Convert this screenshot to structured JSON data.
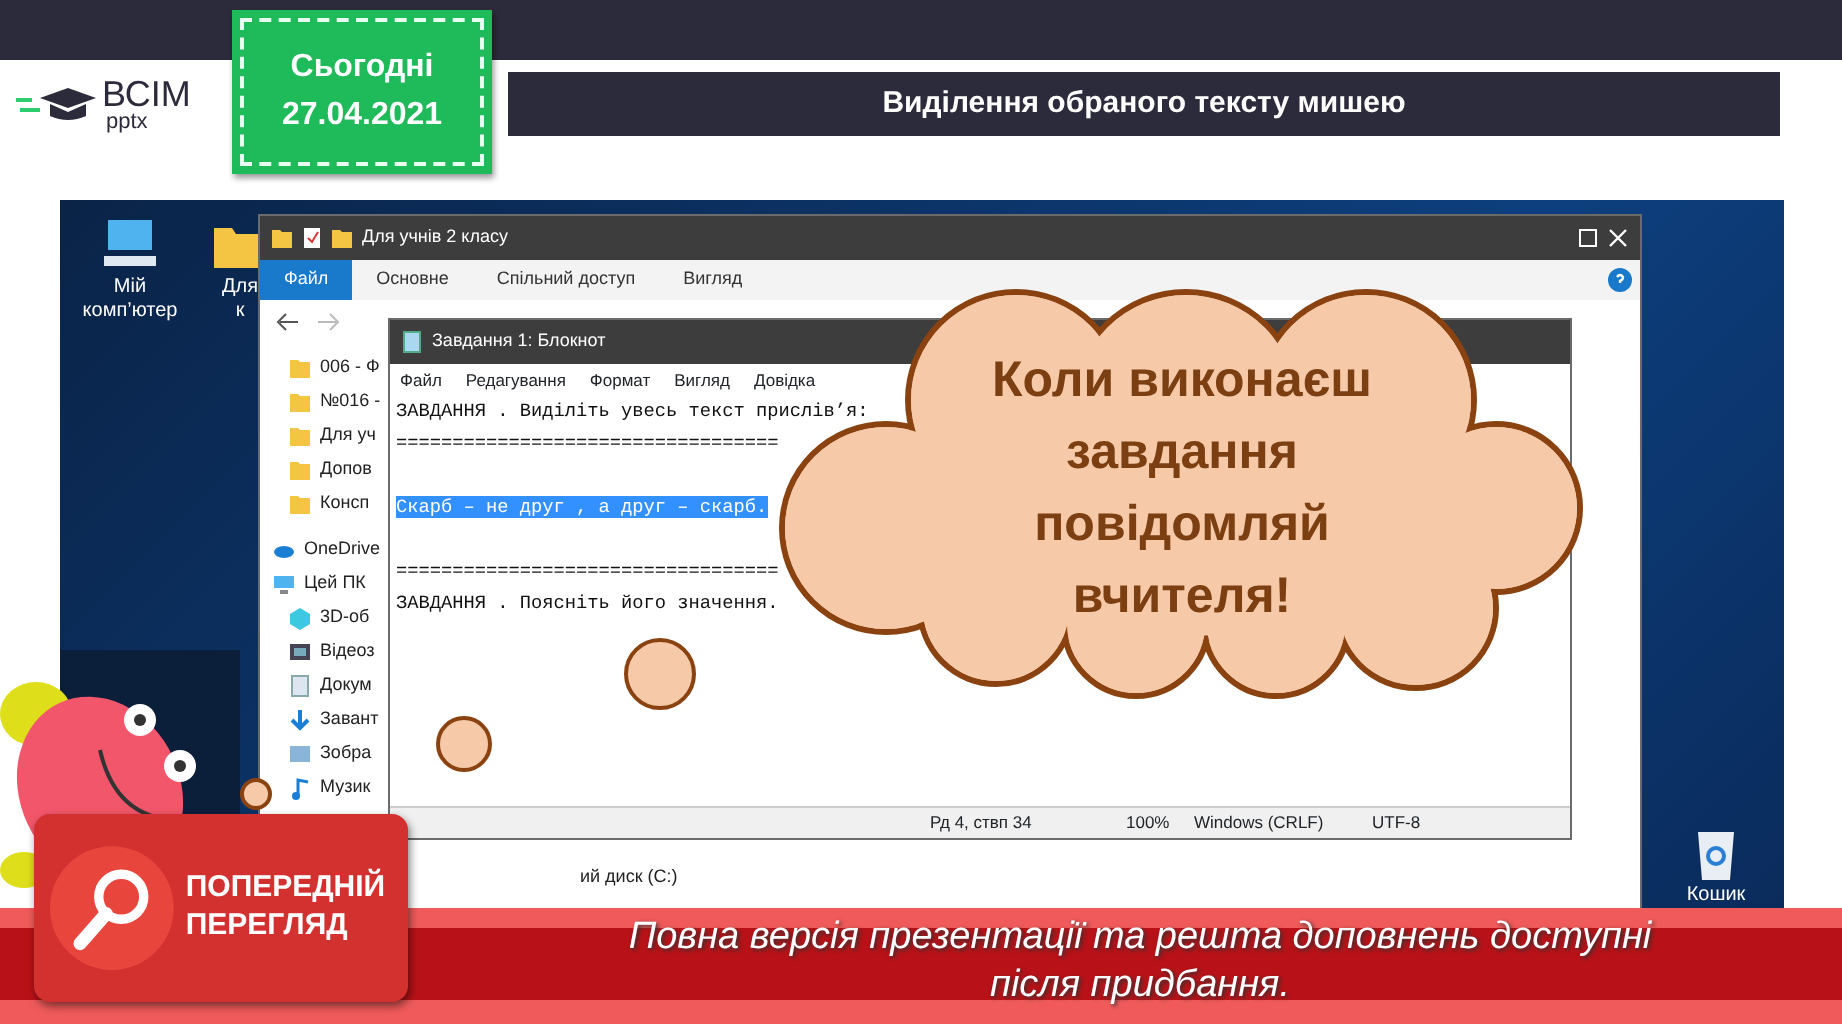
{
  "header": {
    "logo": {
      "title": "ВСІМ",
      "subtitle": "pptx"
    },
    "date_tag": {
      "label": "Сьогодні",
      "date": "27.04.2021"
    },
    "title": "Виділення обраного тексту мишею"
  },
  "desktop": {
    "icons": [
      {
        "label": "Мій комп’ютер",
        "kind": "computer"
      },
      {
        "label": "Для к",
        "kind": "folder"
      },
      {
        "label": "Кошик",
        "kind": "bin"
      }
    ]
  },
  "explorer": {
    "title": "Для учнів 2 класу",
    "tabs": [
      {
        "label": "Файл",
        "selected": true
      },
      {
        "label": "Основне",
        "selected": false
      },
      {
        "label": "Спільний доступ",
        "selected": false
      },
      {
        "label": "Вигляд",
        "selected": false
      }
    ],
    "nav": [
      {
        "label": "006 - Ф",
        "kind": "folder"
      },
      {
        "label": "№016 -",
        "kind": "folder"
      },
      {
        "label": "Для уч",
        "kind": "folder"
      },
      {
        "label": "Допов",
        "kind": "folder"
      },
      {
        "label": "Консп",
        "kind": "folder"
      },
      {
        "label": "OneDrive",
        "kind": "cloud"
      },
      {
        "label": "Цей ПК",
        "kind": "pc"
      },
      {
        "label": "3D-об",
        "kind": "cube"
      },
      {
        "label": "Відеоз",
        "kind": "video"
      },
      {
        "label": "Докум",
        "kind": "document"
      },
      {
        "label": "Завант",
        "kind": "download"
      },
      {
        "label": "Зобра",
        "kind": "image"
      },
      {
        "label": "Музик",
        "kind": "music"
      }
    ],
    "drive": "ий диск (C:)"
  },
  "notepad": {
    "title": "Завдання 1: Блокнот",
    "menu": [
      "Файл",
      "Редагування",
      "Формат",
      "Вигляд",
      "Довідка"
    ],
    "lines": [
      {
        "kind": "text",
        "text": "ЗАВДАННЯ . Виділіть увесь текст прислів’я:",
        "selected": false
      },
      {
        "kind": "text",
        "text": "==================================",
        "selected": false
      },
      {
        "kind": "blank"
      },
      {
        "kind": "text",
        "text": "Скарб – не друг , а друг – скарб.",
        "selected": true
      },
      {
        "kind": "blank"
      },
      {
        "kind": "text",
        "text": "==================================",
        "selected": false
      },
      {
        "kind": "text",
        "text": "ЗАВДАННЯ . Поясніть його значення.",
        "selected": false
      }
    ],
    "status": [
      "Рд 4, ствп 34",
      "100%",
      "Windows (CRLF)",
      "UTF-8"
    ]
  },
  "callout": {
    "text": "Коли виконаєш завдання повідомляй вчителя!"
  },
  "preview_banner": {
    "badge": "ПОПЕРЕДНІЙ ПЕРЕГЛЯД",
    "message": "Повна версія презентації та решта доповнень доступні після придбання."
  }
}
